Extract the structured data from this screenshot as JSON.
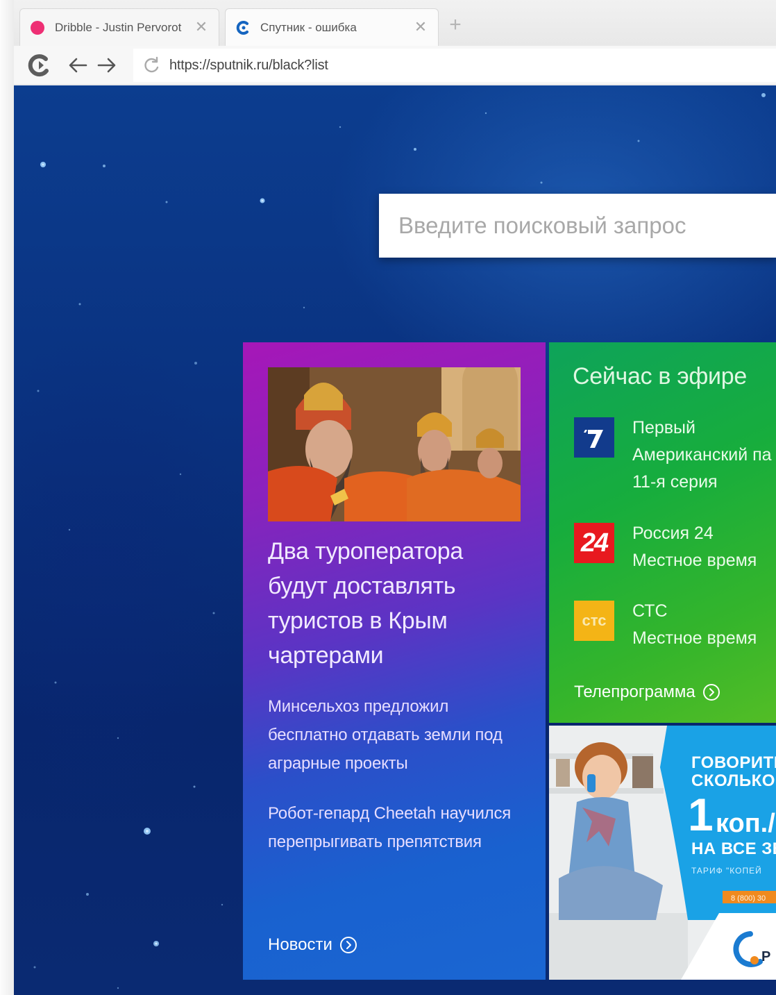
{
  "browser": {
    "tabs": [
      {
        "title": "Dribble - Justin Pervorot",
        "favicon": "dribbble-pink-dot",
        "active": false
      },
      {
        "title": "Спутник - ошибка",
        "favicon": "sputnik-logo",
        "active": true
      }
    ],
    "close_glyph": "✕",
    "new_tab_glyph": "+",
    "address": "https://sputnik.ru/black?list"
  },
  "page": {
    "search": {
      "placeholder": "Введите поисковый запрос"
    },
    "news": {
      "headline": "Два туроператора будут доставлять туристов в Крым чартерами",
      "items": [
        "Минсельхоз предложил бесплатно отдавать земли под аграрные проекты",
        "Робот-гепард Cheetah научился перепрыгивать препятствия"
      ],
      "link_label": "Новости"
    },
    "tv": {
      "title": "Сейчас в эфире",
      "channels": [
        {
          "name": "Первый",
          "program": "Американский па",
          "episode": "11-я серия",
          "logo": "channel-one-logo",
          "logo_text": "1"
        },
        {
          "name": "Россия 24",
          "program": "Местное время",
          "logo": "russia-24-logo",
          "logo_text": "24"
        },
        {
          "name": "СТС",
          "program": "Местное время",
          "logo": "sts-logo",
          "logo_text": "стс"
        }
      ],
      "link_label": "Телепрограмма"
    },
    "ad": {
      "line1": "ГОВОРИТЕ",
      "line2": "СКОЛЬКО Х",
      "price_number": "1",
      "price_unit": "коп./",
      "line4": "НА ВСЕ ЗВ",
      "line5": "ТАРИФ \"КОПЕЙ",
      "line6": "8 (800) 30",
      "logo": "rostelecom-logo",
      "logo_text": "Р"
    }
  },
  "colors": {
    "page_bg": "#0a3280",
    "news_card_top": "#a617b8",
    "news_card_bottom": "#1a66d2",
    "tv_card": "#17ad3d",
    "ad_blue": "#1aa2e6",
    "ad_orange": "#f08a1e"
  }
}
